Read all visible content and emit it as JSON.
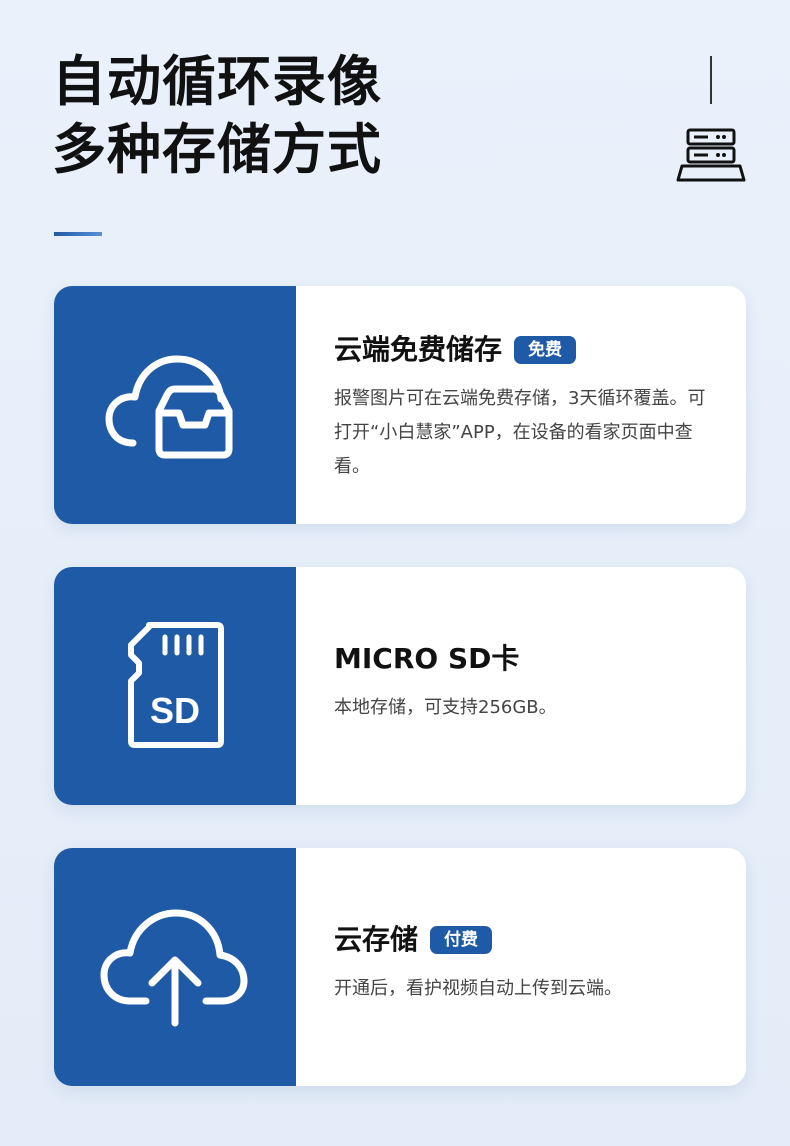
{
  "header": {
    "title_line1": "自动循环录像",
    "title_line2": "多种存储方式"
  },
  "cards": [
    {
      "icon": "cloud-box-icon",
      "title": "云端免费储存",
      "badge": "免费",
      "description": "报警图片可在云端免费存储，3天循环覆盖。可打开“小白慧家”APP，在设备的看家页面中查看。"
    },
    {
      "icon": "sd-card-icon",
      "title": "MICRO SD卡",
      "badge": "",
      "description": "本地存储，可支持256GB。",
      "icon_text": "SD"
    },
    {
      "icon": "cloud-upload-icon",
      "title": "云存储",
      "badge": "付费",
      "description": "开通后，看护视频自动上传到云端。"
    }
  ],
  "colors": {
    "accent": "#1f5aa6",
    "background": "#e6eef9",
    "card": "#ffffff"
  }
}
